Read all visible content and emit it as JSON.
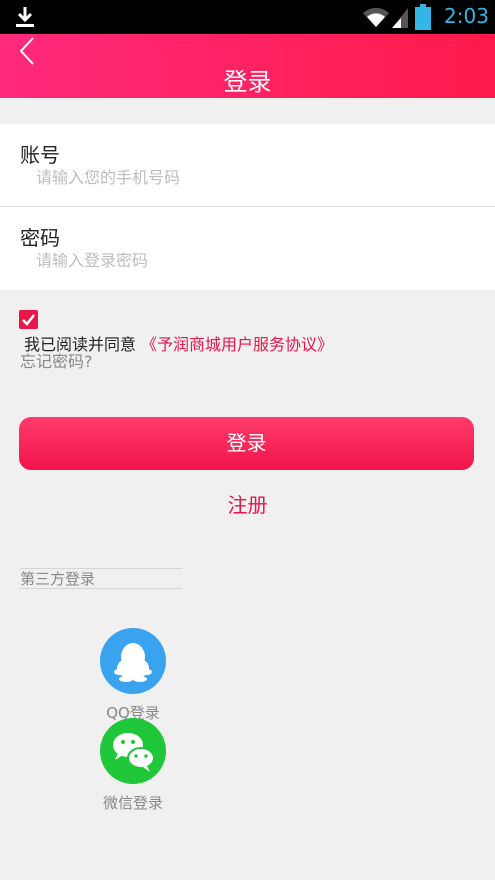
{
  "status_bar": {
    "time": "2:03",
    "icons": [
      "download-icon",
      "wifi-icon",
      "signal-icon",
      "battery-icon"
    ]
  },
  "header": {
    "title": "登录",
    "back_icon": "back-chevron-icon"
  },
  "form": {
    "account": {
      "label": "账号",
      "placeholder": "请输入您的手机号码",
      "value": ""
    },
    "password": {
      "label": "密码",
      "placeholder": "请输入登录密码",
      "value": ""
    }
  },
  "agreement": {
    "checked": true,
    "text": "我已阅读并同意",
    "link": "《予润商城用户服务协议》"
  },
  "forgot_password": "忘记密码?",
  "login_button": "登录",
  "register_link": "注册",
  "third_party": {
    "label": "第三方登录",
    "providers": [
      {
        "name": "QQ登录",
        "icon": "qq-icon",
        "color": "#3aa3f0"
      },
      {
        "name": "微信登录",
        "icon": "wechat-icon",
        "color": "#21c73a"
      }
    ]
  },
  "colors": {
    "brand": "#e8164b",
    "header_gradient_start": "#ff2a7c",
    "header_gradient_end": "#ff1a4a",
    "statusbar_accent": "#33b5e5"
  }
}
